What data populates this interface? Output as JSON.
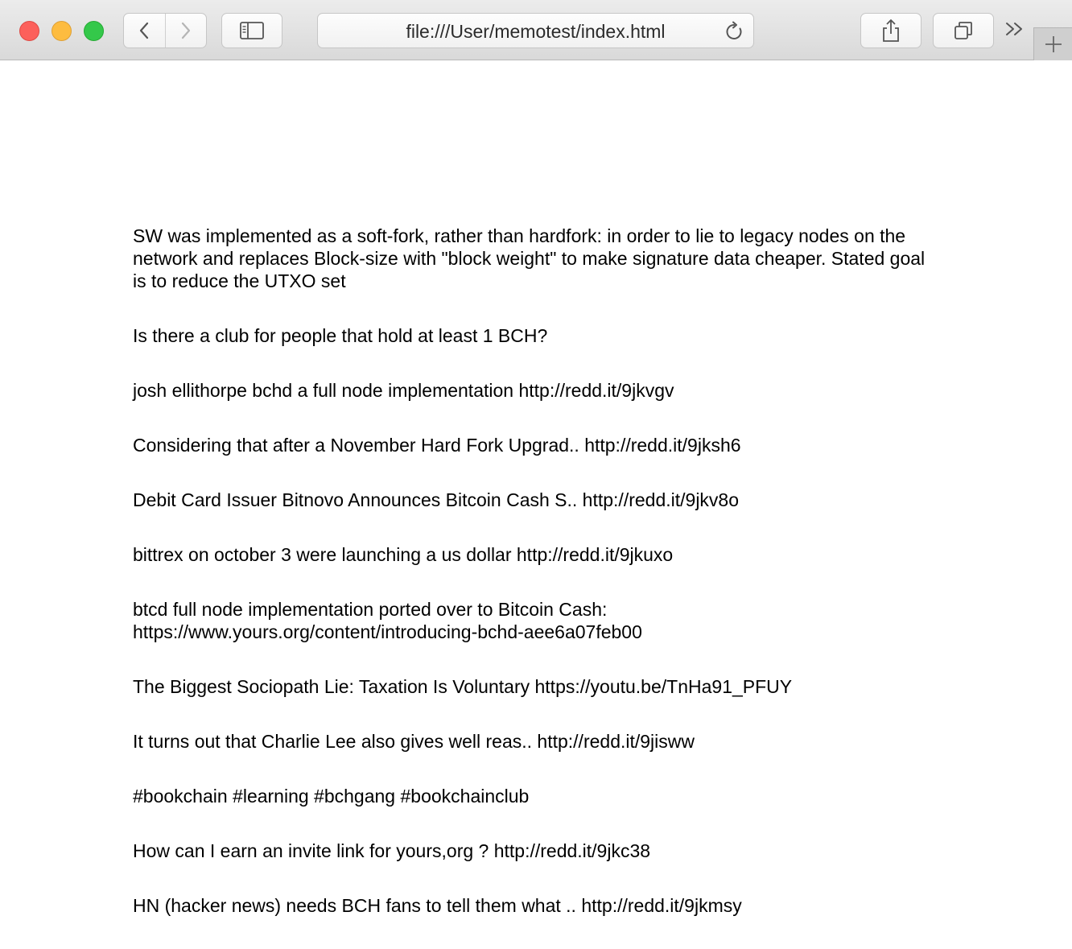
{
  "browser": {
    "address": "file:///User/memotest/index.html",
    "icons": {
      "back": "chevron-left-icon",
      "forward": "chevron-right-icon",
      "sidebar": "sidebar-icon",
      "reload": "reload-icon",
      "share": "share-icon",
      "tabs": "tab-overview-icon",
      "more": "double-chevron-right-icon",
      "new_tab": "plus-icon"
    },
    "colors": {
      "close": "#fc605b",
      "minimize": "#fdbc40",
      "maximize": "#34c84a"
    }
  },
  "posts": [
    "SW was implemented as a soft-fork, rather than hardfork: in order to lie to legacy nodes on the network and replaces Block-size with \"block weight\" to make signature data cheaper. Stated goal is to reduce the UTXO set",
    "Is there a club for people that hold at least 1 BCH?",
    "josh ellithorpe bchd a full node implementation http://redd.it/9jkvgv",
    "Considering that after a November Hard Fork Upgrad.. http://redd.it/9jksh6",
    "Debit Card Issuer Bitnovo Announces Bitcoin Cash S.. http://redd.it/9jkv8o",
    "bittrex on october 3 were launching a us dollar http://redd.it/9jkuxo",
    "btcd full node implementation ported over to Bitcoin Cash: https://www.yours.org/content/introducing-bchd-aee6a07feb00",
    "The Biggest Sociopath Lie: Taxation Is Voluntary https://youtu.be/TnHa91_PFUY",
    "It turns out that Charlie Lee also gives well reas.. http://redd.it/9jisww",
    "#bookchain #learning #bchgang #bookchainclub",
    "How can I earn an invite link for yours,org ? http://redd.it/9jkc38",
    "HN (hacker news) needs BCH fans to tell them what .. http://redd.it/9jkmsy"
  ]
}
